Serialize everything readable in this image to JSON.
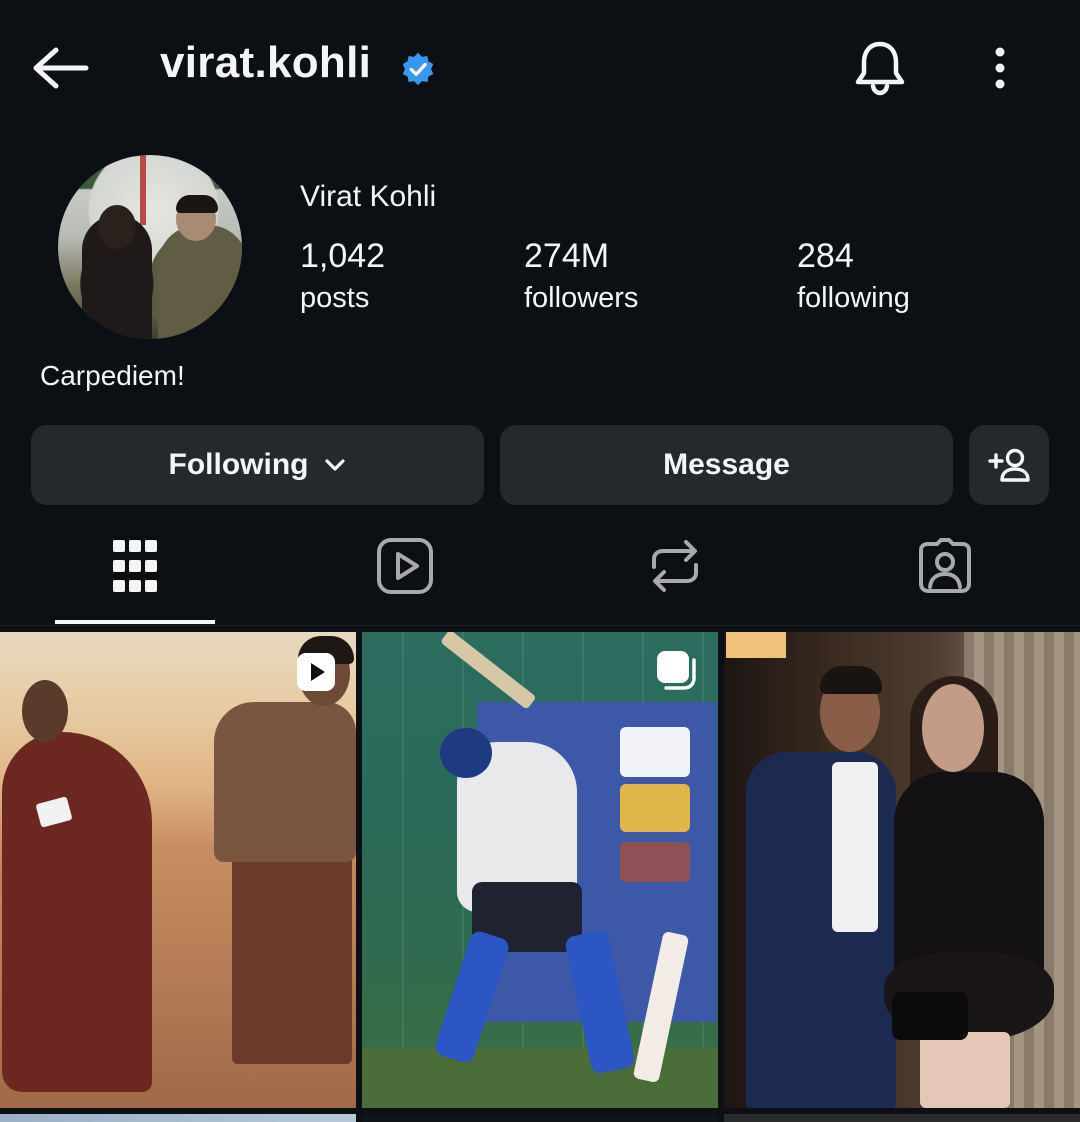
{
  "header": {
    "username": "virat.kohli",
    "back_icon": "arrow-left-icon",
    "verified_icon": "verified-badge-icon",
    "bell_icon": "bell-icon",
    "more_icon": "more-vertical-icon",
    "accent_color": "#3897f0"
  },
  "profile": {
    "display_name": "Virat Kohli",
    "bio": "Carpediem!",
    "stats": [
      {
        "value": "1,042",
        "label": "posts"
      },
      {
        "value": "274M",
        "label": "followers"
      },
      {
        "value": "284",
        "label": "following"
      }
    ]
  },
  "actions": {
    "following_label": "Following",
    "message_label": "Message",
    "add_user_icon": "add-user-icon"
  },
  "tabs": [
    {
      "name": "grid",
      "icon": "grid-icon",
      "active": true
    },
    {
      "name": "reels",
      "icon": "reels-icon",
      "active": false
    },
    {
      "name": "reposts",
      "icon": "repost-icon",
      "active": false
    },
    {
      "name": "tagged",
      "icon": "tagged-icon",
      "active": false
    }
  ],
  "posts": [
    {
      "type": "reel",
      "badge_icon": "reel-icon"
    },
    {
      "type": "carousel",
      "badge_icon": "carousel-icon"
    },
    {
      "type": "photo"
    }
  ],
  "colors": {
    "background": "#0c1014",
    "button_bg": "#25292e",
    "text": "#f5f5f5"
  }
}
